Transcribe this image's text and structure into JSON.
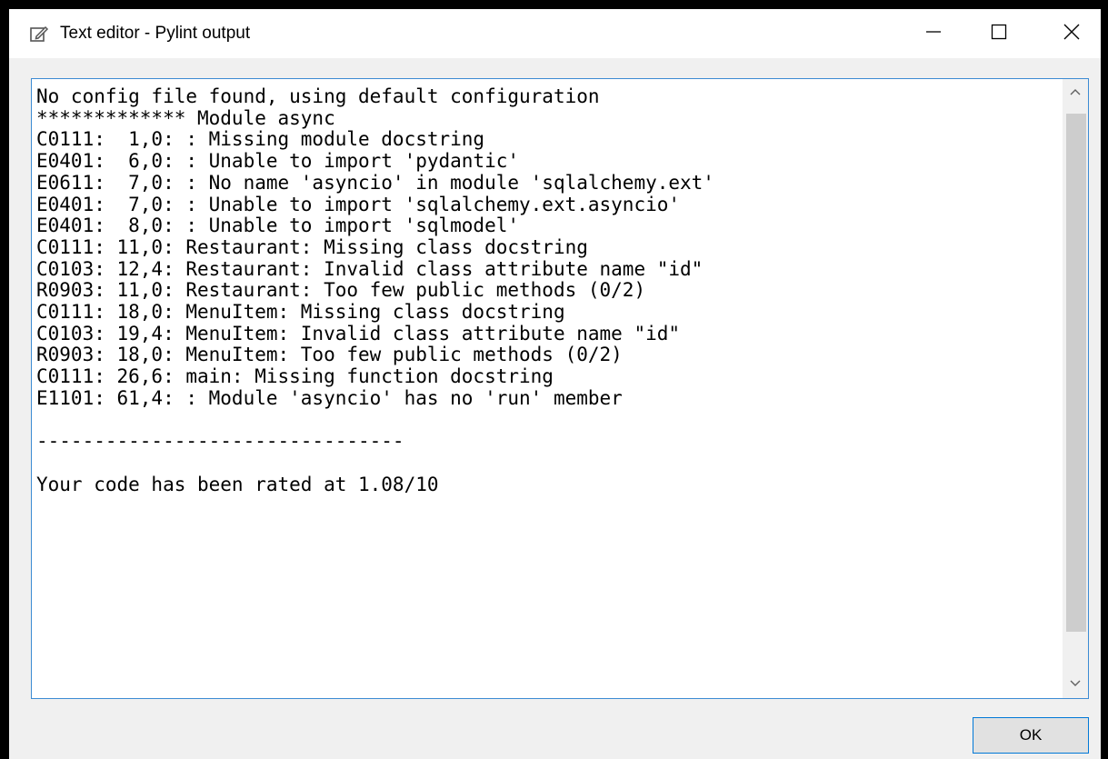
{
  "window": {
    "title": "Text editor - Pylint output"
  },
  "editor": {
    "lines": [
      "No config file found, using default configuration",
      "************* Module async",
      "C0111:  1,0: : Missing module docstring",
      "E0401:  6,0: : Unable to import 'pydantic'",
      "E0611:  7,0: : No name 'asyncio' in module 'sqlalchemy.ext'",
      "E0401:  7,0: : Unable to import 'sqlalchemy.ext.asyncio'",
      "E0401:  8,0: : Unable to import 'sqlmodel'",
      "C0111: 11,0: Restaurant: Missing class docstring",
      "C0103: 12,4: Restaurant: Invalid class attribute name \"id\"",
      "R0903: 11,0: Restaurant: Too few public methods (0/2)",
      "C0111: 18,0: MenuItem: Missing class docstring",
      "C0103: 19,4: MenuItem: Invalid class attribute name \"id\"",
      "R0903: 18,0: MenuItem: Too few public methods (0/2)",
      "C0111: 26,6: main: Missing function docstring",
      "E1101: 61,4: : Module 'asyncio' has no 'run' member",
      "",
      "--------------------------------",
      "",
      "Your code has been rated at 1.08/10"
    ]
  },
  "buttons": {
    "ok_label": "OK"
  },
  "icons": {
    "title": "edit-icon",
    "minimize": "minimize-icon",
    "maximize": "maximize-icon",
    "close": "close-icon",
    "scroll_up": "chevron-up-icon",
    "scroll_down": "chevron-down-icon"
  },
  "colors": {
    "focus_border": "#3c8bd3",
    "ok_border": "#0078d7",
    "scroll_thumb": "#cdcdcd"
  }
}
